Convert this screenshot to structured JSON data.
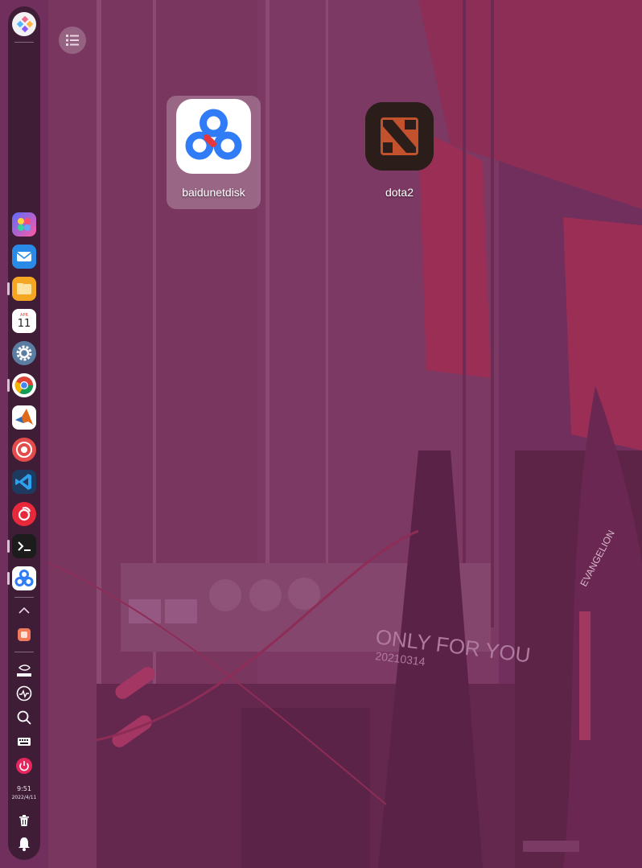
{
  "desktop": {
    "icons": [
      {
        "label": "baidunetdisk",
        "selected": true
      },
      {
        "label": "dota2",
        "selected": false
      }
    ]
  },
  "wallpaper": {
    "text_line1": "ONLY FOR YOU",
    "text_line2": "20210314",
    "side_text": "EVANGELION"
  },
  "dock": {
    "apps": [
      "launcher-icon",
      "mail-icon",
      "file-manager-icon",
      "calendar-icon",
      "settings-icon",
      "chrome-icon",
      "matlab-icon",
      "app-store-icon",
      "vscode-icon",
      "netease-music-icon",
      "terminal-icon",
      "baidunetdisk-icon"
    ],
    "calendar": {
      "month": "APR",
      "day": "11"
    },
    "clock": {
      "time": "9:51",
      "date": "2022/4/11"
    },
    "tray": [
      "nvidia-icon",
      "system-monitor-icon",
      "search-icon",
      "keyboard-icon",
      "power-icon"
    ]
  },
  "colors": {
    "wallpaper_tint": "#6e2d59",
    "dock_bg": "#2d1628",
    "power_red": "#e8265e",
    "baidu_blue": "#2f7cf6"
  }
}
